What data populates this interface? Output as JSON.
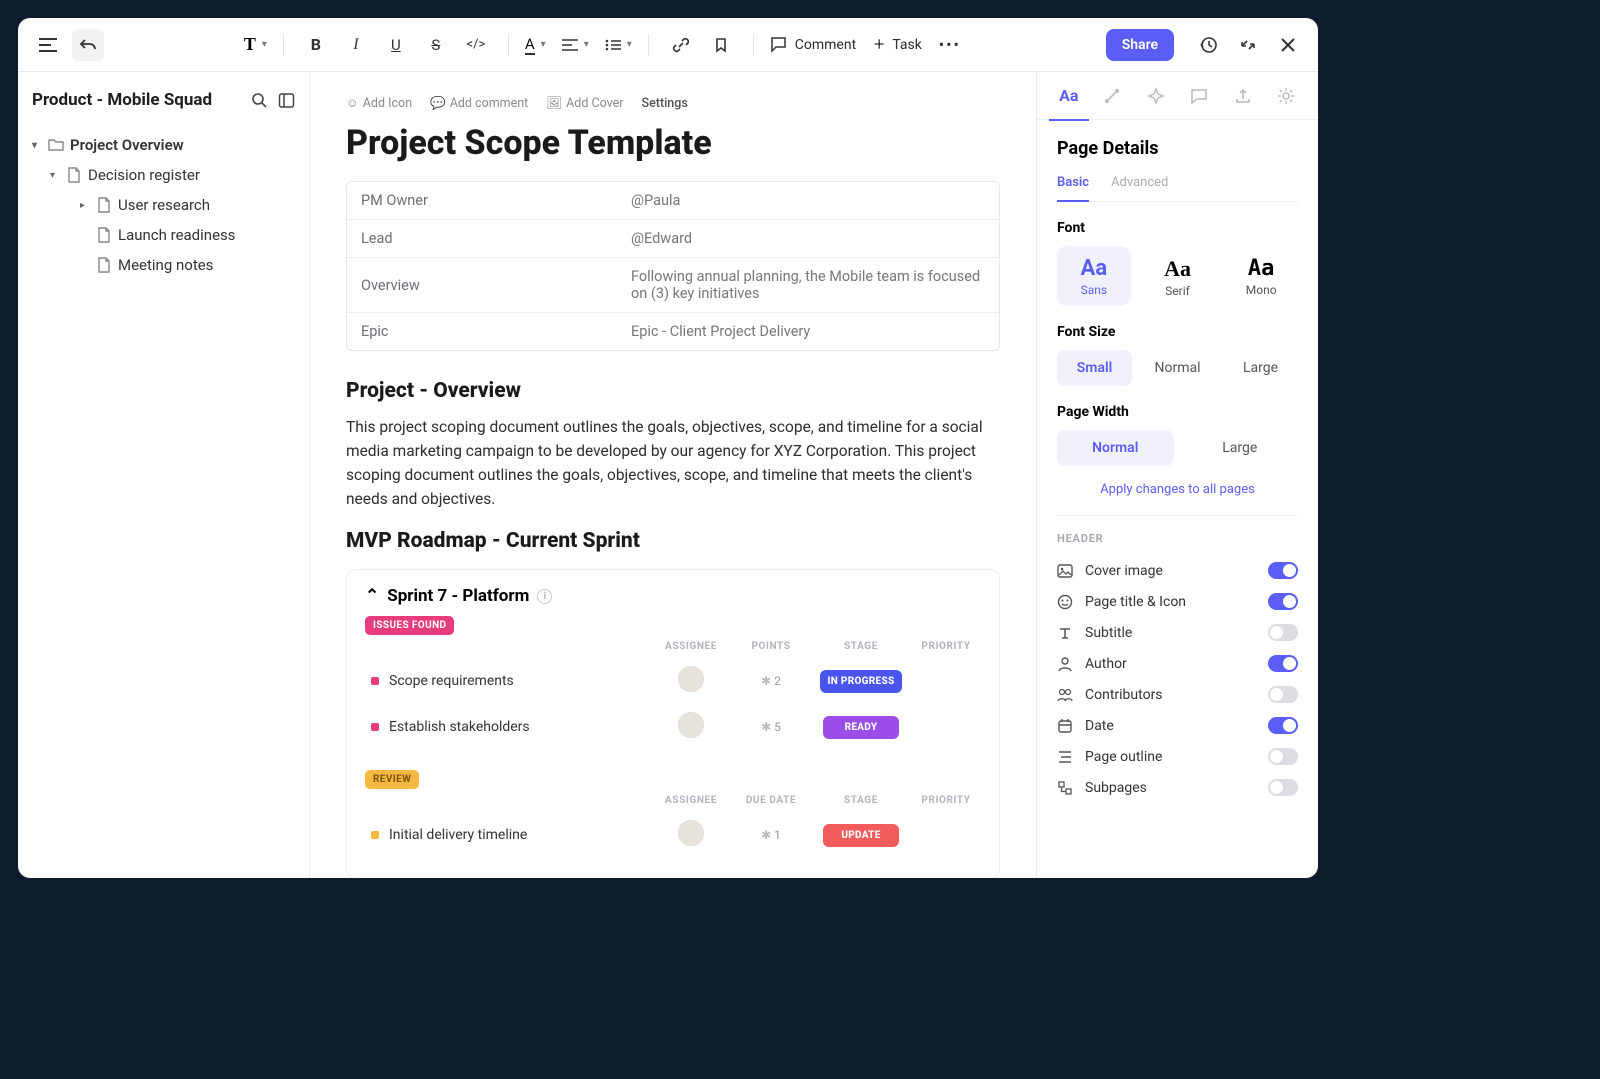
{
  "toolbar": {
    "comment_label": "Comment",
    "task_label": "Task",
    "share_label": "Share"
  },
  "sidebar": {
    "title": "Product - Mobile Squad",
    "tree": [
      {
        "label": "Project Overview",
        "level": 0,
        "icon": "folder",
        "caret": "down"
      },
      {
        "label": "Decision register",
        "level": 1,
        "icon": "doc",
        "caret": "down"
      },
      {
        "label": "User research",
        "level": 2,
        "icon": "doc",
        "caret": "right"
      },
      {
        "label": "Launch readiness",
        "level": 2,
        "icon": "doc",
        "caret": ""
      },
      {
        "label": "Meeting notes",
        "level": 2,
        "icon": "doc",
        "caret": ""
      }
    ]
  },
  "page_actions": {
    "add_icon": "Add Icon",
    "add_comment": "Add comment",
    "add_cover": "Add Cover",
    "settings": "Settings"
  },
  "page": {
    "title": "Project Scope Template",
    "info_rows": [
      {
        "k": "PM Owner",
        "v": "@Paula"
      },
      {
        "k": "Lead",
        "v": "@Edward"
      },
      {
        "k": "Overview",
        "v": "Following annual planning, the Mobile team is focused on (3) key initiatives"
      },
      {
        "k": "Epic",
        "v": "Epic - Client Project Delivery"
      }
    ],
    "h_overview": "Project - Overview",
    "overview_body": "This project scoping document outlines the goals, objectives, scope, and timeline for a social media marketing campaign to be developed by our agency for XYZ Corporation. This project scoping document outlines the goals, objectives, scope, and timeline that meets the client's needs and objectives.",
    "h_roadmap": "MVP Roadmap - Current Sprint"
  },
  "sprint": {
    "title": "Sprint  7 - Platform",
    "groups": [
      {
        "tag": "ISSUES FOUND",
        "tag_color": "pink",
        "cols": [
          "ASSIGNEE",
          "POINTS",
          "STAGE",
          "PRIORITY"
        ],
        "points_label": "POINTS",
        "tasks": [
          {
            "name": "Scope requirements",
            "points": "2",
            "stage": "IN PROGRESS",
            "stage_color": "blue",
            "flag": "yellow",
            "dot": "pink"
          },
          {
            "name": "Establish stakeholders",
            "points": "5",
            "stage": "READY",
            "stage_color": "purple",
            "flag": "yellow",
            "dot": "pink"
          }
        ]
      },
      {
        "tag": "REVIEW",
        "tag_color": "orange",
        "cols": [
          "ASSIGNEE",
          "DUE DATE",
          "STAGE",
          "PRIORITY"
        ],
        "points_label": "DUE DATE",
        "tasks": [
          {
            "name": "Initial delivery timeline",
            "points": "1",
            "stage": "UPDATE",
            "stage_color": "red",
            "flag": "green",
            "dot": "orange"
          }
        ]
      }
    ]
  },
  "rpanel": {
    "title": "Page Details",
    "tab_basic": "Basic",
    "tab_advanced": "Advanced",
    "font_label": "Font",
    "fonts": [
      {
        "big": "Aa",
        "lbl": "Sans",
        "active": true,
        "cls": ""
      },
      {
        "big": "Aa",
        "lbl": "Serif",
        "active": false,
        "cls": "serif"
      },
      {
        "big": "Aa",
        "lbl": "Mono",
        "active": false,
        "cls": "mono"
      }
    ],
    "fontsize_label": "Font Size",
    "sizes": [
      {
        "lbl": "Small",
        "active": true
      },
      {
        "lbl": "Normal",
        "active": false
      },
      {
        "lbl": "Large",
        "active": false
      }
    ],
    "width_label": "Page Width",
    "widths": [
      {
        "lbl": "Normal",
        "active": true
      },
      {
        "lbl": "Large",
        "active": false
      }
    ],
    "apply_all": "Apply changes to all pages",
    "header_label": "HEADER",
    "options": [
      {
        "lbl": "Cover image",
        "icon": "image",
        "on": true
      },
      {
        "lbl": "Page title & Icon",
        "icon": "smile",
        "on": true
      },
      {
        "lbl": "Subtitle",
        "icon": "text",
        "on": false
      },
      {
        "lbl": "Author",
        "icon": "user",
        "on": true
      },
      {
        "lbl": "Contributors",
        "icon": "users",
        "on": false
      },
      {
        "lbl": "Date",
        "icon": "calendar",
        "on": true
      },
      {
        "lbl": "Page outline",
        "icon": "outline",
        "on": false
      },
      {
        "lbl": "Subpages",
        "icon": "subpages",
        "on": false
      }
    ]
  }
}
